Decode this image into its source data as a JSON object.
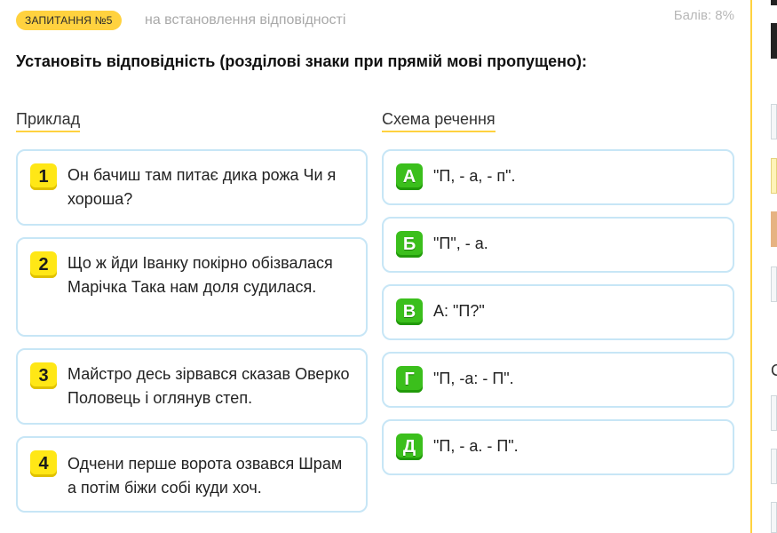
{
  "header": {
    "badge": "ЗАПИТАННЯ №5",
    "type": "на встановлення відповідності",
    "score": "Балів: 8%"
  },
  "question": "Установіть відповідність (розділові знаки при прямій мові пропущено):",
  "columns": {
    "left_title": "Приклад",
    "right_title": "Схема речення"
  },
  "examples": [
    {
      "num": "1",
      "text": "Он бачиш там питає дика рожа Чи я хороша?"
    },
    {
      "num": "2",
      "text": "Що ж йди Іванку покірно обізвалася Марічка Така нам доля судилася."
    },
    {
      "num": "3",
      "text": "Майстро десь зірвався сказав Оверко Половець і оглянув степ."
    },
    {
      "num": "4",
      "text": "Одчени перше ворота озвався Шрам а потім біжи собі куди хоч."
    }
  ],
  "schemes": [
    {
      "letter": "А",
      "text": "\"П, - а, - п\"."
    },
    {
      "letter": "Б",
      "text": "\"П\", - а."
    },
    {
      "letter": "В",
      "text": "А: \"П?\""
    },
    {
      "letter": "Г",
      "text": "\"П, -а: - П\"."
    },
    {
      "letter": "Д",
      "text": "\"П, - а. - П\"."
    }
  ],
  "sidebar": {
    "peek_char": "С"
  },
  "colors": {
    "accent_yellow": "#ffd23f",
    "number_yellow": "#ffe716",
    "letter_green": "#3bbf1c",
    "card_border": "#c7e6f6"
  }
}
